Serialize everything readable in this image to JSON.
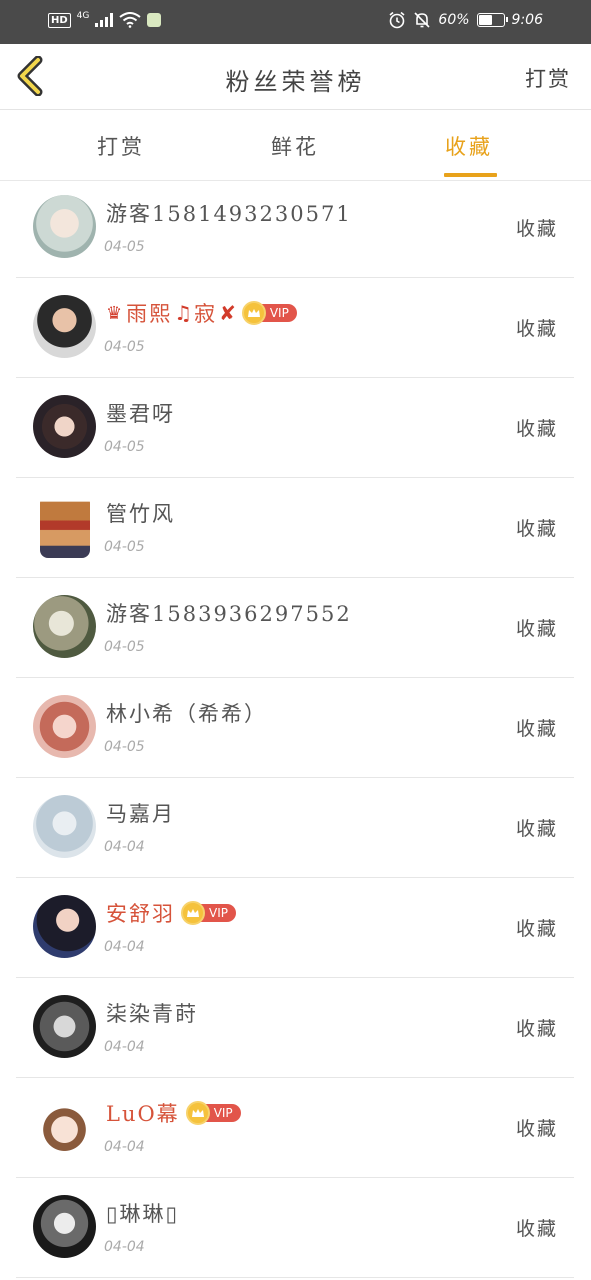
{
  "status_bar": {
    "hd": "HD",
    "network": "4G",
    "battery_text": "60%",
    "battery_level": 0.6,
    "time": "9:06"
  },
  "header": {
    "title": "粉丝荣誉榜",
    "action_label": "打赏"
  },
  "tabs": [
    {
      "label": "打赏",
      "active": false
    },
    {
      "label": "鲜花",
      "active": false
    },
    {
      "label": "收藏",
      "active": true
    }
  ],
  "accent_color": "#e8a21b",
  "vip_color": "#d6533a",
  "rows": [
    {
      "name": "游客1581493230571",
      "date": "04-05",
      "action": "收藏",
      "vip": false
    },
    {
      "name_prefix": "♛",
      "name": "雨熙",
      "name_mid": "♫",
      "name_rest": "寂",
      "name_suffix": "✘",
      "date": "04-05",
      "action": "收藏",
      "vip": true,
      "vip_label": "VIP"
    },
    {
      "name": "墨君呀",
      "date": "04-05",
      "action": "收藏",
      "vip": false
    },
    {
      "name": "管竹风",
      "date": "04-05",
      "action": "收藏",
      "vip": false
    },
    {
      "name": "游客1583936297552",
      "date": "04-05",
      "action": "收藏",
      "vip": false
    },
    {
      "name": "林小希（希希）",
      "date": "04-05",
      "action": "收藏",
      "vip": false
    },
    {
      "name": "马嘉月",
      "date": "04-04",
      "action": "收藏",
      "vip": false
    },
    {
      "name": "安舒羽",
      "date": "04-04",
      "action": "收藏",
      "vip": true,
      "vip_label": "VIP"
    },
    {
      "name": "柒染青莳",
      "date": "04-04",
      "action": "收藏",
      "vip": false
    },
    {
      "name": "LuO幕",
      "date": "04-04",
      "action": "收藏",
      "vip": true,
      "vip_label": "VIP"
    },
    {
      "name": "▯琳琳▯",
      "date": "04-04",
      "action": "收藏",
      "vip": false
    }
  ]
}
